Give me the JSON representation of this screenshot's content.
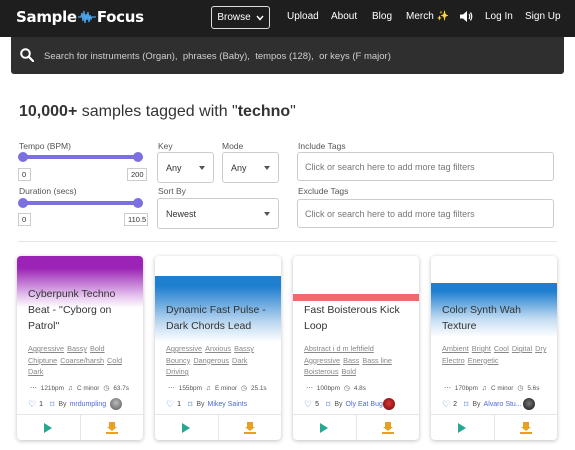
{
  "nav": {
    "logo_left": "Sample",
    "logo_right": "Focus",
    "browse": "Browse",
    "upload": "Upload",
    "about": "About",
    "blog": "Blog",
    "merch": "Merch ✨",
    "login": "Log In",
    "signup": "Sign Up"
  },
  "search": {
    "placeholder": "Search for instruments (Organ),  phrases (Baby),  tempos (128),  or keys (F major)"
  },
  "heading": {
    "count": "10,000+",
    "middle": " samples tagged with \"",
    "tag": "techno",
    "end": "\""
  },
  "filters": {
    "tempo_label": "Tempo (BPM)",
    "tempo_min": "0",
    "tempo_max": "200",
    "duration_label": "Duration (secs)",
    "duration_min": "0",
    "duration_max": "110.5",
    "key_label": "Key",
    "key_value": "Any",
    "mode_label": "Mode",
    "mode_value": "Any",
    "sort_label": "Sort By",
    "sort_value": "Newest",
    "include_label": "Include Tags",
    "include_placeholder": "Click or search here to add more tag filters",
    "exclude_label": "Exclude Tags",
    "exclude_placeholder": "Click or search here to add more tag filters"
  },
  "cards": [
    {
      "title": "Cyberpunk Techno Beat - ''Cyborg on Patrol''",
      "tags": [
        "Aggressive",
        "Bassy",
        "Bold",
        "Chiptune",
        "Coarse/harsh",
        "Cold",
        "Dark"
      ],
      "bpm": "121bpm",
      "key": "C minor",
      "duration": "63.7s",
      "likes": "1",
      "by": "By",
      "user": "mrdumpling",
      "color": "#9b23b5"
    },
    {
      "title": "Dynamic Fast Pulse - Dark Chords Lead",
      "tags": [
        "Aggressive",
        "Anxious",
        "Bassy",
        "Bouncy",
        "Dangerous",
        "Dark",
        "Driving"
      ],
      "bpm": "155bpm",
      "key": "E minor",
      "duration": "25.1s",
      "likes": "1",
      "by": "By",
      "user": "Mikey Saints",
      "color": "#1e7ecf"
    },
    {
      "title": "Fast Boisterous Kick Loop",
      "tags": [
        "Abstract i d m leftfield",
        "Aggressive",
        "Bass",
        "Bass line",
        "Boisterous",
        "Bold"
      ],
      "bpm": "100bpm",
      "key": "",
      "duration": "4.8s",
      "likes": "5",
      "by": "By",
      "user": "Oly Eat Bug",
      "color": "#ef6b6b"
    },
    {
      "title": "Color Synth Wah Texture",
      "tags": [
        "Ambient",
        "Bright",
        "Cool",
        "Digital",
        "Dry",
        "Electro",
        "Energetic"
      ],
      "bpm": "170bpm",
      "key": "C minor",
      "duration": "5.6s",
      "likes": "2",
      "by": "By",
      "user": "Alvaro Stu...",
      "color": "#1e7ecf"
    }
  ],
  "colors": {
    "topbar": "#1e1e1e",
    "search": "#2f2f2f",
    "slider": "#7c6fe0",
    "play": "#27a78f",
    "download": "#e8a020"
  }
}
